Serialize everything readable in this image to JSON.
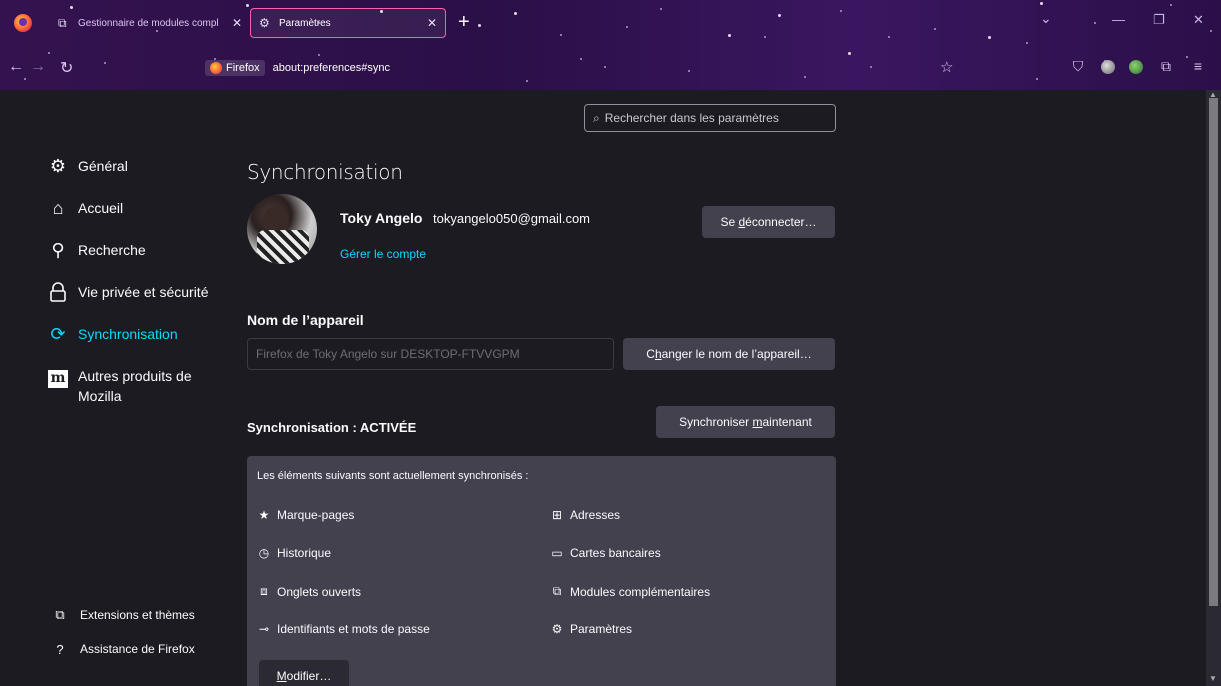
{
  "browser": {
    "tabs": [
      {
        "label": "Gestionnaire de modules compl",
        "icon": "puzzle-icon",
        "active": false
      },
      {
        "label": "Paramètres",
        "icon": "gear-icon",
        "active": true
      }
    ],
    "url_identity": "Firefox",
    "url": "about:preferences#sync",
    "colors": {
      "theme_purple": "#2b0f47",
      "tab_highlight": "#ff5fa8"
    }
  },
  "search": {
    "placeholder": "Rechercher dans les paramètres"
  },
  "sidebar": {
    "items": [
      {
        "label": "Général",
        "icon": "gear-icon"
      },
      {
        "label": "Accueil",
        "icon": "home-icon"
      },
      {
        "label": "Recherche",
        "icon": "search-icon"
      },
      {
        "label": "Vie privée et sécurité",
        "icon": "lock-icon"
      },
      {
        "label": "Synchronisation",
        "icon": "sync-icon",
        "active": true
      },
      {
        "label": "Autres produits de Mozilla",
        "icon": "mozilla-icon"
      }
    ],
    "footer": [
      {
        "label": "Extensions et thèmes",
        "icon": "puzzle-icon"
      },
      {
        "label": "Assistance de Firefox",
        "icon": "help-icon"
      }
    ]
  },
  "main": {
    "title": "Synchronisation",
    "account": {
      "name": "Toky Angelo",
      "email": "tokyangelo050@gmail.com",
      "manage_link": "Gérer le compte",
      "signout_pre": "Se ",
      "signout_key": "d",
      "signout_post": "éconnecter…"
    },
    "device": {
      "label": "Nom de l’appareil",
      "value": "Firefox de Toky Angelo sur DESKTOP-FTVVGPM",
      "rename_pre": "C",
      "rename_key": "h",
      "rename_post": "anger le nom de l’appareil…"
    },
    "sync": {
      "status": "Synchronisation : ACTIVÉE",
      "syncnow_pre": "Synchroniser ",
      "syncnow_key": "m",
      "syncnow_post": "aintenant",
      "intro": "Les éléments suivants sont actuellement synchronisés :",
      "items_left": [
        {
          "label": "Marque-pages",
          "icon": "star-icon"
        },
        {
          "label": "Historique",
          "icon": "clock-icon"
        },
        {
          "label": "Onglets ouverts",
          "icon": "tabs-icon"
        },
        {
          "label": "Identifiants et mots de passe",
          "icon": "key-icon"
        }
      ],
      "items_right": [
        {
          "label": "Adresses",
          "icon": "address-icon"
        },
        {
          "label": "Cartes bancaires",
          "icon": "card-icon"
        },
        {
          "label": "Modules complémentaires",
          "icon": "puzzle-icon"
        },
        {
          "label": "Paramètres",
          "icon": "gear-icon"
        }
      ],
      "modify_key": "M",
      "modify_post": "odifier…"
    },
    "colors": {
      "accent": "#00ddff",
      "button_bg": "#42414d",
      "page_bg": "#1c1b22"
    }
  }
}
